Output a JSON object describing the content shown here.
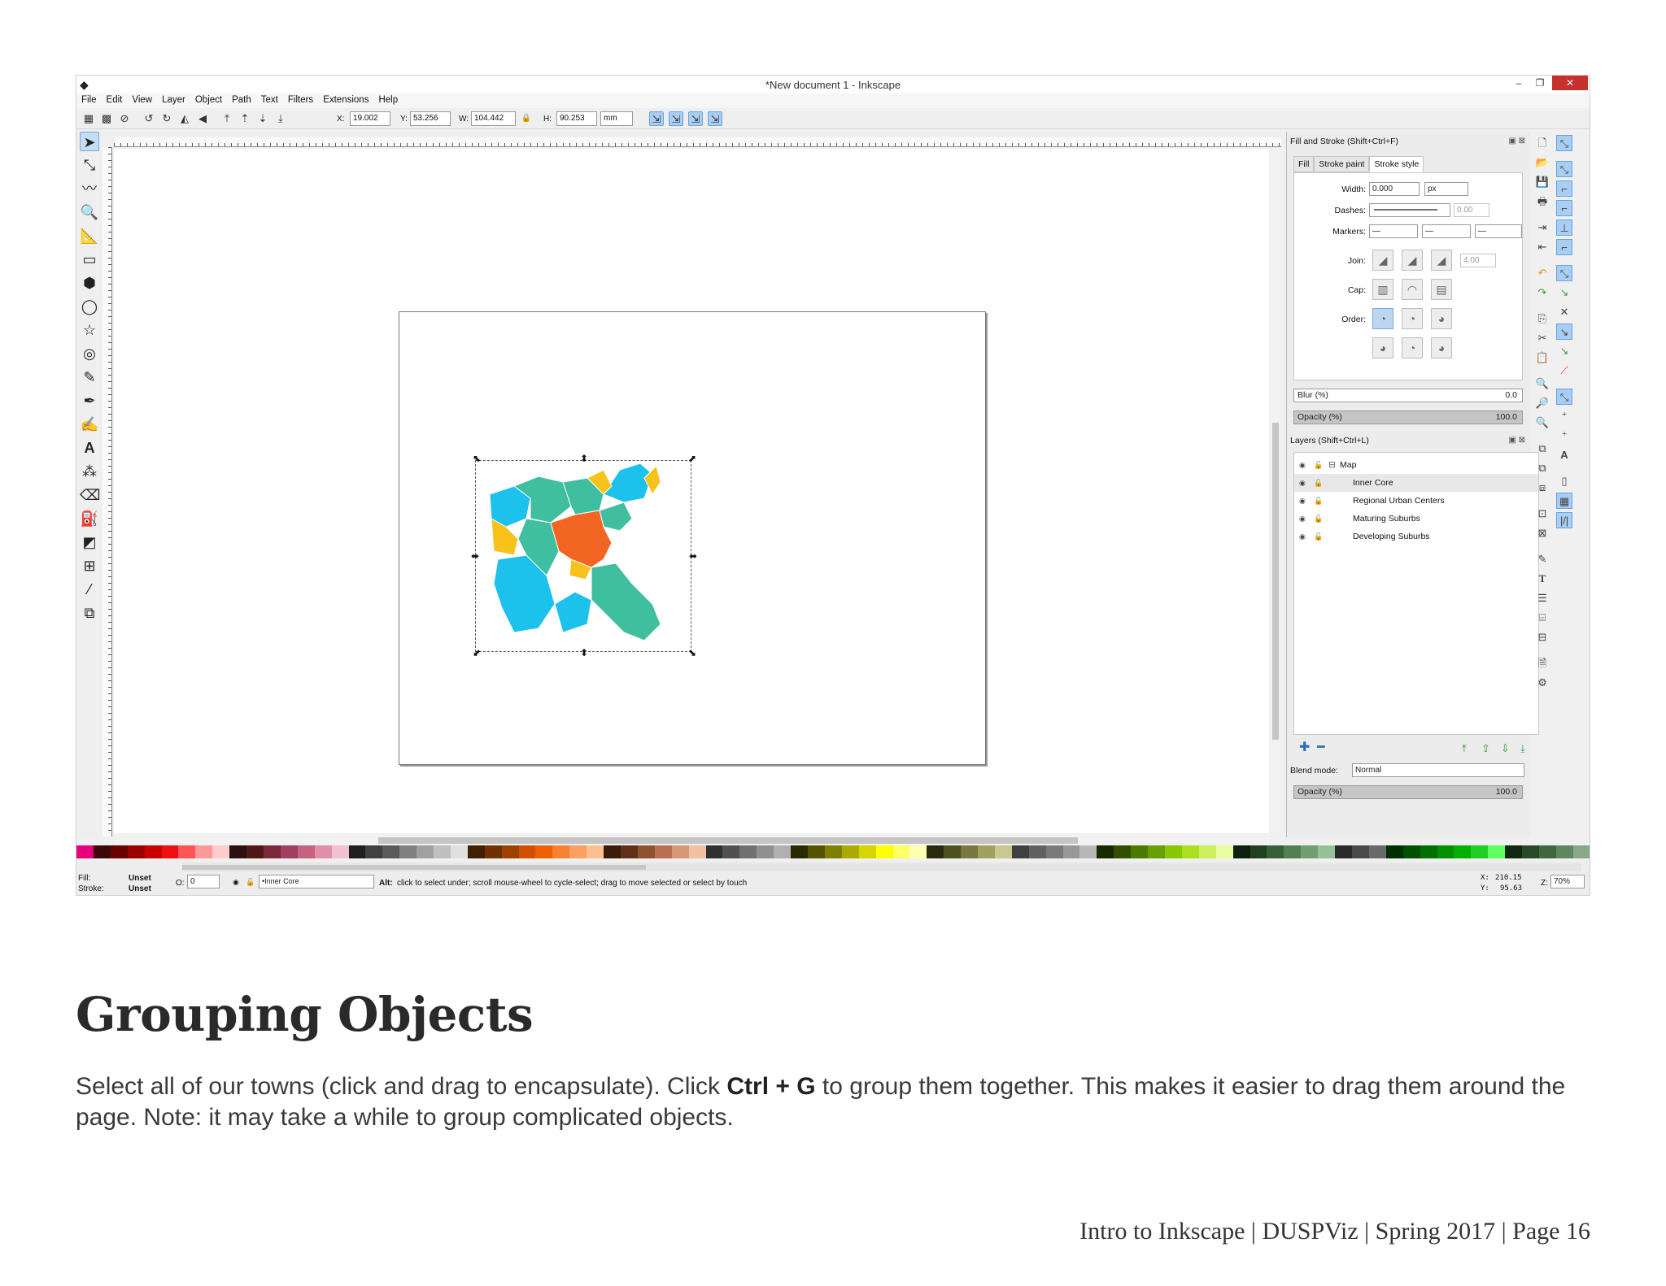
{
  "window": {
    "title": "*New document 1 - Inkscape",
    "controls": {
      "minimize": "–",
      "restore": "❐",
      "close": "✕"
    }
  },
  "menu": [
    "File",
    "Edit",
    "View",
    "Layer",
    "Object",
    "Path",
    "Text",
    "Filters",
    "Extensions",
    "Help"
  ],
  "controls_bar": {
    "x_label": "X:",
    "x_value": "19.002",
    "y_label": "Y:",
    "y_value": "53.256",
    "w_label": "W:",
    "w_value": "104.442",
    "h_label": "H:",
    "h_value": "90.253",
    "unit": "mm"
  },
  "fill_stroke": {
    "title": "Fill and Stroke (Shift+Ctrl+F)",
    "tabs": [
      "Fill",
      "Stroke paint",
      "Stroke style"
    ],
    "active_tab": "Stroke style",
    "width_label": "Width:",
    "width_value": "0.000",
    "width_unit": "px",
    "dashes_label": "Dashes:",
    "dashes_value": "0.00",
    "markers_label": "Markers:",
    "join_label": "Join:",
    "join_value": "4.00",
    "cap_label": "Cap:",
    "order_label": "Order:",
    "blur_label": "Blur (%)",
    "blur_value": "0.0",
    "blur_percent": 0,
    "opacity_label": "Opacity (%)",
    "opacity_value": "100.0",
    "opacity_percent": 100
  },
  "layers_panel": {
    "title": "Layers (Shift+Ctrl+L)",
    "layers": [
      {
        "name": "Map",
        "depth": 0,
        "selected": false
      },
      {
        "name": "Inner Core",
        "depth": 1,
        "selected": true
      },
      {
        "name": "Regional Urban Centers",
        "depth": 1,
        "selected": false
      },
      {
        "name": "Maturing Suburbs",
        "depth": 1,
        "selected": false
      },
      {
        "name": "Developing Suburbs",
        "depth": 1,
        "selected": false
      }
    ],
    "blend_label": "Blend mode:",
    "blend_value": "Normal",
    "opacity_label": "Opacity (%)",
    "opacity_value": "100.0",
    "opacity_percent": 100
  },
  "status": {
    "fill_label": "Fill:",
    "fill_value": "Unset",
    "stroke_label": "Stroke:",
    "stroke_value": "Unset",
    "o_label": "O:",
    "o_value": "0",
    "layer_value": "•Inner Core",
    "message_bold": "Alt:",
    "message": "click to select under; scroll mouse-wheel to cycle-select; drag to move selected or select by touch",
    "x_label": "X:",
    "x_value": "210.15",
    "y_label": "Y:",
    "y_value": "95.63",
    "zoom_label": "Z:",
    "zoom_value": "70%"
  },
  "map_colors": {
    "inner_core": "#f26522",
    "regional_urban": "#f7c21b",
    "maturing_suburbs": "#3fbf9f",
    "developing_suburbs": "#1cc1ec"
  },
  "document": {
    "heading": "Grouping Objects",
    "body_before": "Select all of our towns (click and drag to encapsulate). Click ",
    "body_shortcut": "Ctrl + G",
    "body_after": " to group them together. This makes it easier to drag them around the page. Note: it may take a while to group complicated objects.",
    "footer": "Intro to Inkscape | DUSPViz | Spring 2017 | Page 16"
  }
}
